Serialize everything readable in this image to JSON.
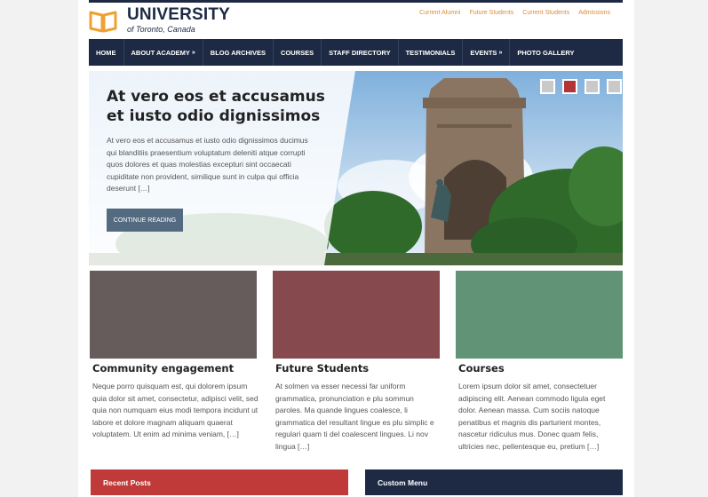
{
  "brand": {
    "title": "UNIVERSITY",
    "subtitle": "of Toronto, Canada"
  },
  "top_links": [
    "Current Alumni",
    "Future Students",
    "Current Students",
    "Admissions"
  ],
  "nav": {
    "items": [
      {
        "label": "HOME",
        "has_submenu": false
      },
      {
        "label": "ABOUT ACADEMY",
        "has_submenu": true
      },
      {
        "label": "BLOG ARCHIVES",
        "has_submenu": false
      },
      {
        "label": "COURSES",
        "has_submenu": false
      },
      {
        "label": "STAFF DIRECTORY",
        "has_submenu": false
      },
      {
        "label": "TESTIMONIALS",
        "has_submenu": false
      },
      {
        "label": "EVENTS",
        "has_submenu": true
      },
      {
        "label": "PHOTO GALLERY",
        "has_submenu": false
      }
    ],
    "submenu_marker": "»"
  },
  "slider": {
    "title": "At vero eos et accusamus et iusto odio dignissimos",
    "text": "At vero eos et accusamus et iusto odio dignissimos ducimus qui blanditiis praesentium voluptatum deleniti atque corrupti quos dolores et quas molestias excepturi sint occaecati cupiditate non provident, similique sunt in culpa qui officia deserunt […]",
    "button": "CONTINUE READING",
    "dot_count": 4,
    "active_dot": 2
  },
  "cards": [
    {
      "title": "Community engagement",
      "text": "Neque porro quisquam est, qui dolorem ipsum quia dolor sit amet, consectetur, adipisci velit, sed quia non numquam eius modi tempora incidunt ut labore et dolore magnam aliquam quaerat voluptatem. Ut enim ad minima veniam, […]",
      "color": "#675c5c"
    },
    {
      "title": "Future Students",
      "text": "At solmen va esser necessi far uniform grammatica, pronunciation e plu sommun paroles. Ma quande lingues coalesce, li grammatica del resultant lingue es plu simplic e regulari quam ti del coalescent lingues. Li nov lingua […]",
      "color": "#864a4e"
    },
    {
      "title": "Courses",
      "text": "Lorem ipsum dolor sit amet, consectetuer adipiscing elit. Aenean commodo ligula eget dolor. Aenean massa. Cum sociis natoque penatibus et magnis dis parturient montes, nascetur ridiculus mus. Donec quam felis, ultricies nec, pellentesque eu, pretium […]",
      "color": "#619377"
    }
  ],
  "widgets": [
    {
      "title": "Recent Posts",
      "color": "#c13a3a"
    },
    {
      "title": "Custom Menu",
      "color": "#1e2a44"
    }
  ],
  "colors": {
    "navy": "#1e2a44",
    "link_orange": "#d98c3c",
    "logo_orange": "#f0a030",
    "button": "#546a80"
  },
  "icons": {
    "logo": "open-book-icon"
  }
}
